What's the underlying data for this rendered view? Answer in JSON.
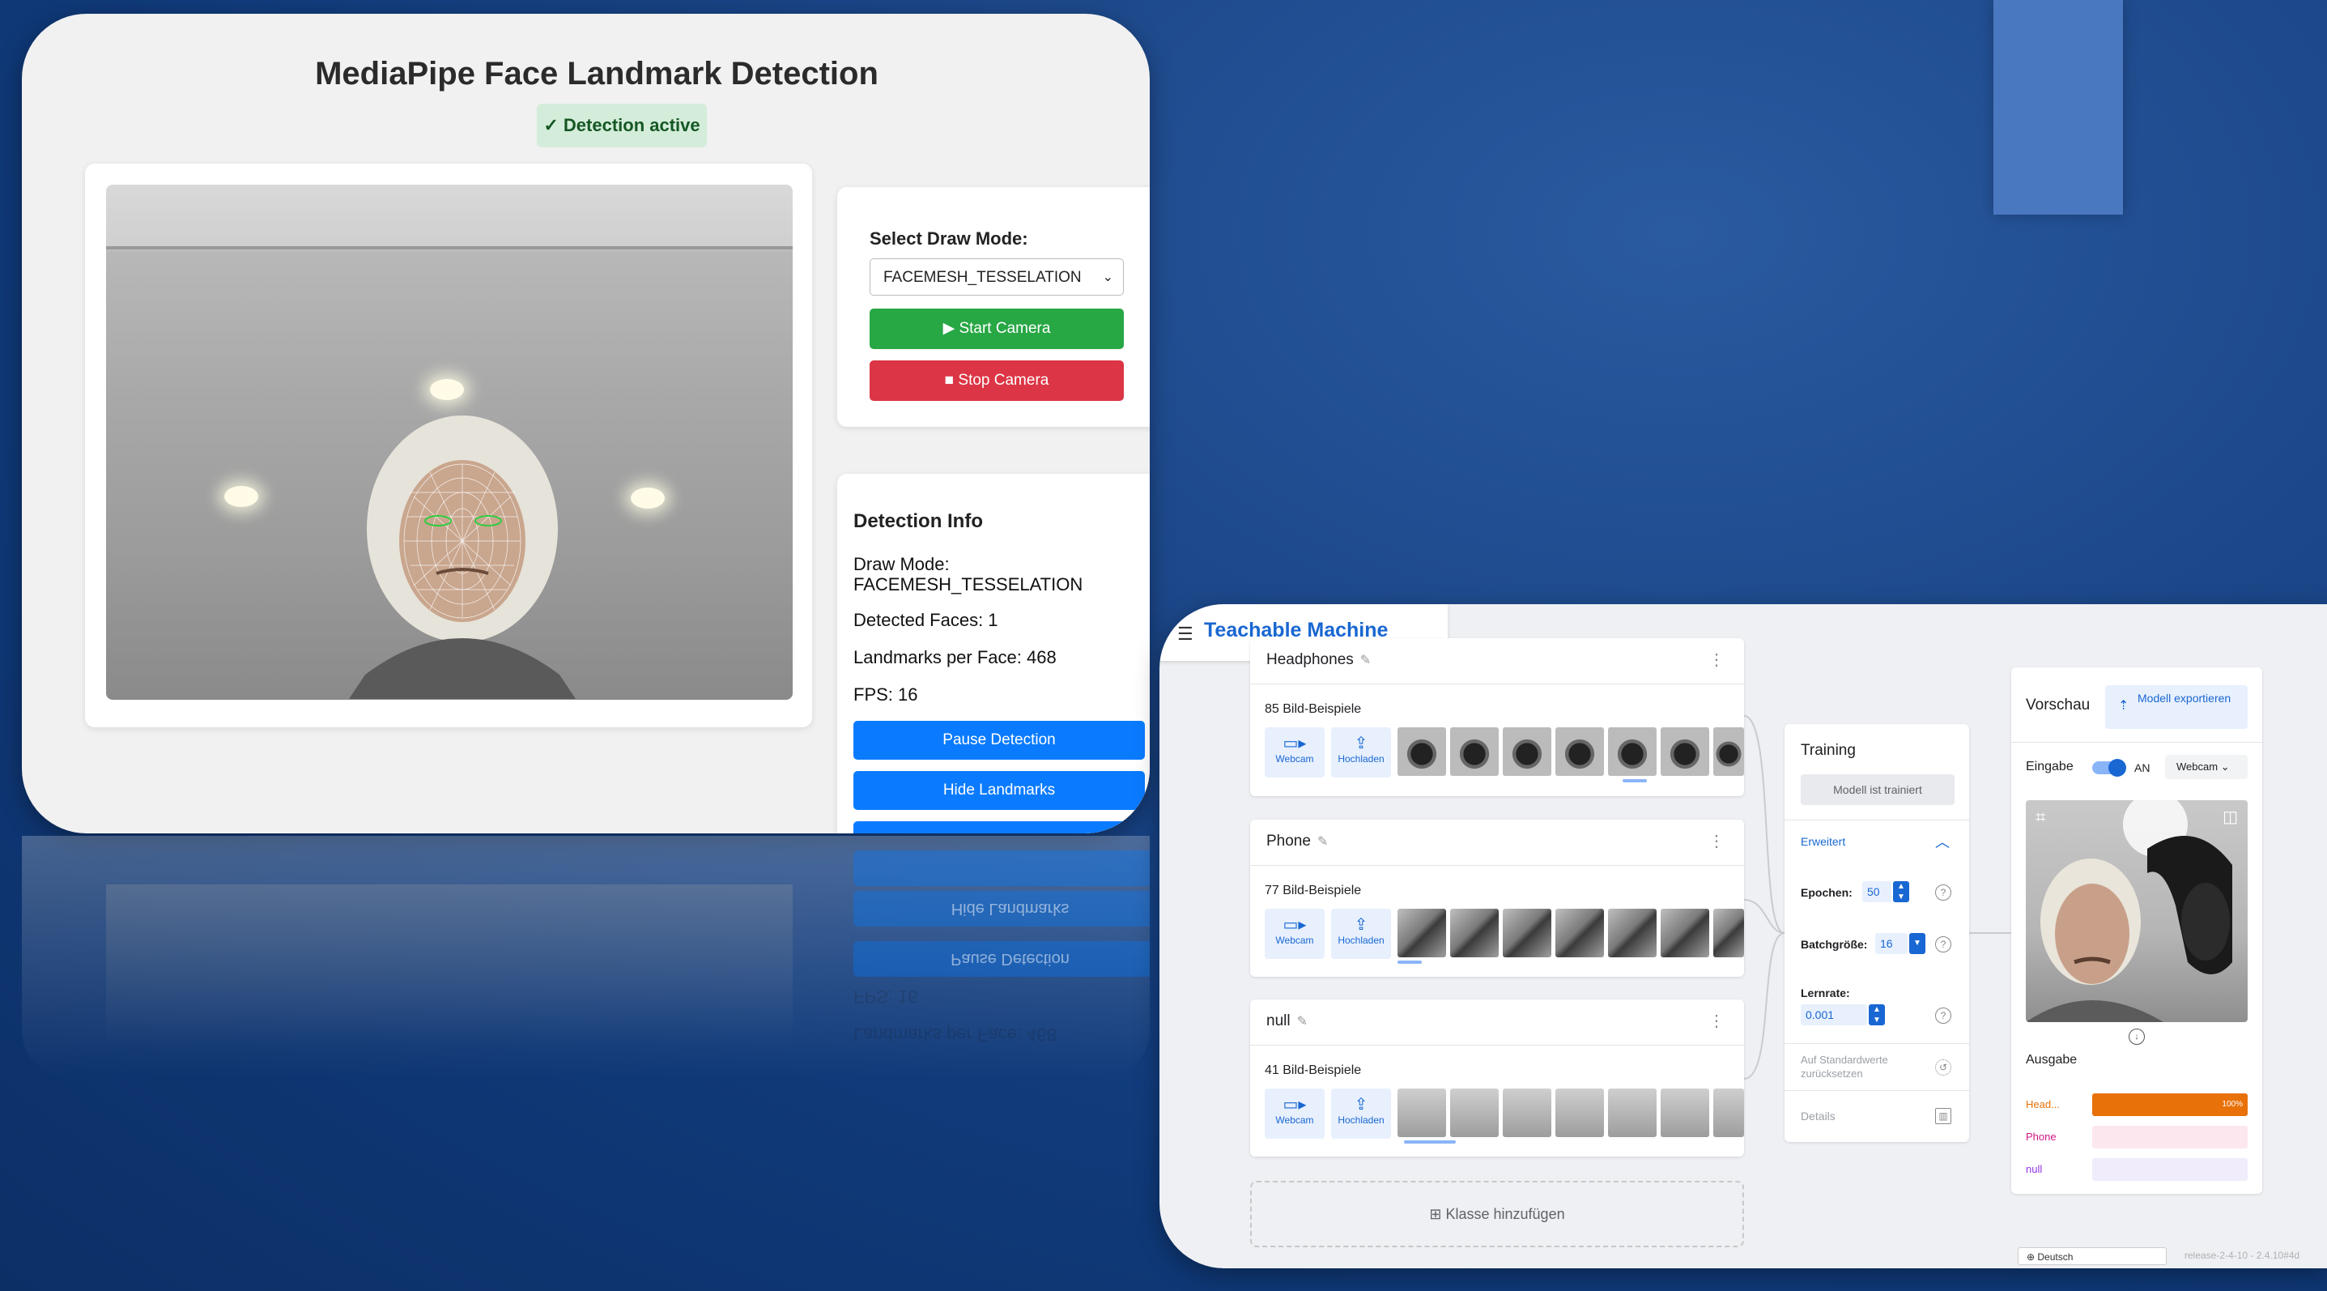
{
  "mediapipe": {
    "title": "MediaPipe Face Landmark Detection",
    "status_badge": "✓ Detection active",
    "controls": {
      "select_label": "Select Draw Mode:",
      "selected_mode": "FACEMESH_TESSELATION",
      "start_button": "▶ Start Camera",
      "stop_button": "■ Stop Camera"
    },
    "info": {
      "heading": "Detection Info",
      "draw_mode_label": "Draw Mode:",
      "draw_mode_value": "FACEMESH_TESSELATION",
      "detected_faces": "Detected Faces: 1",
      "landmarks": "Landmarks per Face: 468",
      "fps": "FPS: 16",
      "pause_button": "Pause Detection",
      "hide_button": "Hide Landmarks"
    }
  },
  "teachable": {
    "app_title": "Teachable Machine",
    "classes": [
      {
        "name": "Headphones",
        "count": "85 Bild-Beispiele"
      },
      {
        "name": "Phone",
        "count": "77 Bild-Beispiele"
      },
      {
        "name": "null",
        "count": "41 Bild-Beispiele"
      }
    ],
    "webcam_label": "Webcam",
    "upload_label": "Hochladen",
    "add_class": "Klasse hinzufügen",
    "training": {
      "title": "Training",
      "trained_button": "Modell ist trainiert",
      "advanced": "Erweitert",
      "epochs_label": "Epochen:",
      "epochs_value": "50",
      "batch_label": "Batchgröße:",
      "batch_value": "16",
      "lr_label": "Lernrate:",
      "lr_value": "0.001",
      "reset": "Auf Standardwerte zurücksetzen",
      "details": "Details"
    },
    "preview": {
      "title": "Vorschau",
      "export_button": "Modell exportieren",
      "input_label": "Eingabe",
      "toggle_state": "AN",
      "input_source": "Webcam",
      "output_label": "Ausgabe",
      "outputs": [
        {
          "label": "Head...",
          "value": 100,
          "display": "100%",
          "color": "#e8710a",
          "track": "#fce8d4"
        },
        {
          "label": "Phone",
          "value": 0,
          "display": "",
          "color": "#d01884",
          "track": "#fde7ef"
        },
        {
          "label": "null",
          "value": 0,
          "display": "",
          "color": "#9334e6",
          "track": "#f0ecfb"
        }
      ]
    },
    "language": "Deutsch",
    "release": "release-2-4-10 - 2.4.10#4d"
  }
}
